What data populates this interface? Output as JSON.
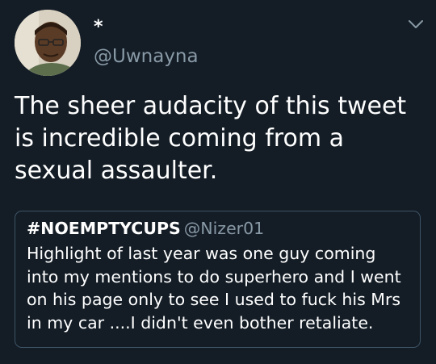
{
  "author": {
    "display_name": "*",
    "handle": "@Uwnayna",
    "avatar_icon": "person-photo"
  },
  "menu": {
    "icon": "chevron-down-icon",
    "color": "#8899a6"
  },
  "tweet": {
    "text": "The sheer audacity of this tweet is incredible coming from a sexual assaulter."
  },
  "quoted_tweet": {
    "name": "#NOEMPTYCUPS",
    "handle": "@Nizer01",
    "text": "Highlight of last year was one guy coming into my mentions to do superhero and I went on his page only to see I used to fuck his Mrs in my car ....I didn't even bother retaliate."
  },
  "colors": {
    "background": "#141d26",
    "text": "#ffffff",
    "secondary_text": "#8899a6",
    "card_border": "#3d5466"
  }
}
